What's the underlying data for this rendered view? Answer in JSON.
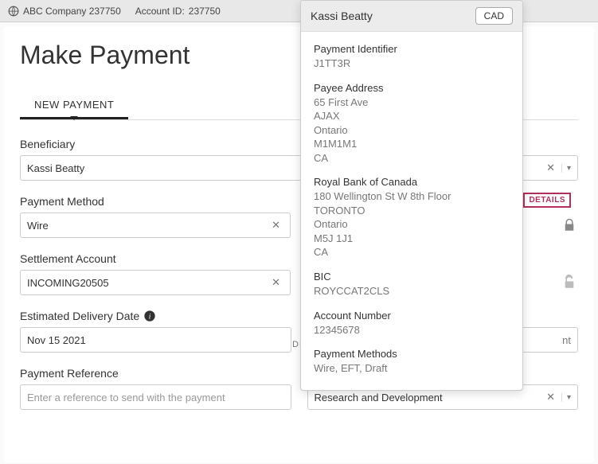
{
  "topbar": {
    "company": "ABC Company 237750",
    "account_label": "Account ID:",
    "account_id": "237750"
  },
  "page_title": "Make Payment",
  "tabs": {
    "new_payment": "NEW PAYMENT"
  },
  "form": {
    "beneficiary": {
      "label": "Beneficiary",
      "value": "Kassi Beatty"
    },
    "payment_method": {
      "label": "Payment Method",
      "value": "Wire"
    },
    "settlement_account": {
      "label": "Settlement Account",
      "value": "INCOMING20505"
    },
    "details_badge": "DETAILS",
    "details_trunc": "DET",
    "delivery_date": {
      "label": "Estimated Delivery Date",
      "value": "Nov 15 2021"
    },
    "right_fragment": "nt",
    "reference": {
      "label": "Payment Reference",
      "placeholder": "Enter a reference to send with the payment"
    },
    "category": {
      "value": "Research and Development"
    }
  },
  "popover": {
    "name": "Kassi Beatty",
    "currency": "CAD",
    "payment_identifier": {
      "label": "Payment Identifier",
      "value": "J1TT3R"
    },
    "payee_address": {
      "label": "Payee Address",
      "lines": [
        "65 First Ave",
        "AJAX",
        "Ontario",
        "M1M1M1",
        "CA"
      ]
    },
    "bank": {
      "name": "Royal Bank of Canada",
      "lines": [
        "180 Wellington St W 8th Floor",
        "TORONTO",
        "Ontario",
        "M5J 1J1",
        "CA"
      ]
    },
    "bic": {
      "label": "BIC",
      "value": "ROYCCAT2CLS"
    },
    "account_number": {
      "label": "Account Number",
      "value": "12345678"
    },
    "payment_methods": {
      "label": "Payment Methods",
      "value": "Wire, EFT, Draft"
    }
  }
}
